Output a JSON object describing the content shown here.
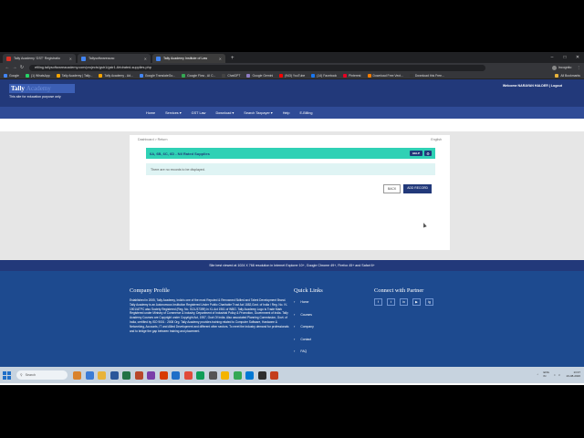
{
  "browser": {
    "tabs": [
      {
        "label": "Tally Academy 'GST' Registratio",
        "fav": "#d93025",
        "active": false
      },
      {
        "label": "Tallysoftwareacac",
        "fav": "#4285f4",
        "active": false
      },
      {
        "label": "Tally Academy Institute of Law",
        "fav": "#4285f4",
        "active": true
      }
    ],
    "new_tab": "+",
    "url": "efiling.tallysoftwareacademy.com/projects/gstr1/gstr1-6rtdrated-supplies.php",
    "incognito": "Incognito",
    "bookmarks": [
      {
        "label": "Google",
        "fav": "#4285f4"
      },
      {
        "label": "(1) WhatsApp",
        "fav": "#25d366"
      },
      {
        "label": "Tally Academy | Tally...",
        "fav": "#f4a300"
      },
      {
        "label": "Tally Academy - Ad...",
        "fav": "#f4a300"
      },
      {
        "label": "Google TranslateGo...",
        "fav": "#4285f4"
      },
      {
        "label": "Google Flow - AI C...",
        "fav": "#34a853"
      },
      {
        "label": "ChatGPT",
        "fav": "#444444"
      },
      {
        "label": "Google Gemini",
        "fav": "#8e7cc3"
      },
      {
        "label": "(943) YouTube",
        "fav": "#ff0000"
      },
      {
        "label": "(14) Facebook",
        "fav": "#1877f2"
      },
      {
        "label": "Pinterest",
        "fav": "#e60023"
      },
      {
        "label": "Download Free Vect...",
        "fav": "#f57c00"
      },
      {
        "label": "Download this Free...",
        "fav": "#333333"
      }
    ],
    "all_bookmarks": "All Bookmarks"
  },
  "site": {
    "logo_main": "Tally",
    "logo_sub": "Academy",
    "edu_note": "This site for education purpose only",
    "welcome": "Welcome NARAYAN HALDER | Logout",
    "nav": [
      "Home",
      "Services ▾",
      "GST Law",
      "Download ▾",
      "Search Taxpayer ▾",
      "Help",
      "E-Billing"
    ],
    "breadcrumb": "Dashboard > Return",
    "language": "English",
    "section_title": "6A, 6B, 6C, 6D - Nil Rated Supplies",
    "help_label": "HELP",
    "gear_glyph": "⚙",
    "no_records": "There are no records to be displayed.",
    "back_label": "BACK",
    "add_label": "ADD RECORD",
    "support_note": "Site best viewed at 1024 X 768 resolution in Internet Explorer 10+, Google Chrome 49+, Firefox 45+ and Safari 6+",
    "company_heading": "Company Profile",
    "company_text": "Established in 2005, Tally Academy, India's one of the most Reputed & Renowned Skilled and Talent Development Brand. Tally Academy is an Autonomous Institution Registered Under Public Charitable Trust Act 1882,Govt. of India / Reg. No. IV-1901/ATPC also Society Registered (Reg. No. S/2L/37399) in XL Act 1961 of WBG. Tally Academy Logo is Trade Mark Registered under Ministry of Commerce & Industry, Department of Industrial Policy & Promotion, Government of India. Tally Academy Courses are Copyright under Copyright Act, 1957, Govt.Of India. Also associated Planning Commission, Govt. of India, certified by ISO 9001 : 2008 Org. Tally Academy provides training related to Computer Software, Hardware & Networking, Accounts, IT and Allied Development and different other sectors. To meet the industry demand for professionals and to bridge the gap between training and placement.",
    "quick_heading": "Quick Links",
    "quick_links": [
      "Home",
      "Courses",
      "Company",
      "Contact",
      "FAQ"
    ],
    "connect_heading": "Connect with Partner",
    "social_icons": [
      "f",
      "t",
      "in",
      "▶",
      "ig"
    ]
  },
  "taskbar": {
    "search_placeholder": "Search",
    "icons": [
      "#d9822b",
      "#3a7bd5",
      "#e8b33a",
      "#2b579a",
      "#217346",
      "#b7472a",
      "#7a3da8",
      "#d83b01",
      "#1f6fc8",
      "#e04b3a",
      "#0f9d58",
      "#555555",
      "#f4b400",
      "#34a853",
      "#0078d4",
      "#2d2d2d",
      "#c43e1c"
    ],
    "lang": "ENG\nIN",
    "time": "13:37",
    "date": "23-08-2026"
  }
}
